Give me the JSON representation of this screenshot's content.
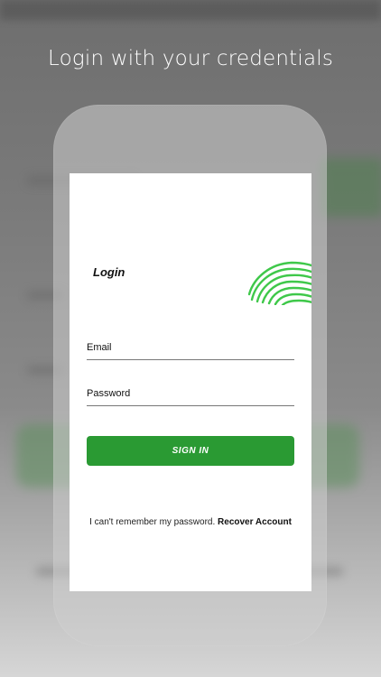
{
  "promo": {
    "headline": "Login with your credentials"
  },
  "login_screen": {
    "title": "Login",
    "email_label": "Email",
    "password_label": "Password",
    "sign_in_label": "SIGN IN",
    "forgot_text": "I can't remember my password.",
    "recover_label": "Recover Account"
  },
  "colors": {
    "accent_green": "#2a9a33",
    "fingerprint_green": "#3fc84a"
  },
  "icons": {
    "brand": "fingerprint-icon"
  }
}
